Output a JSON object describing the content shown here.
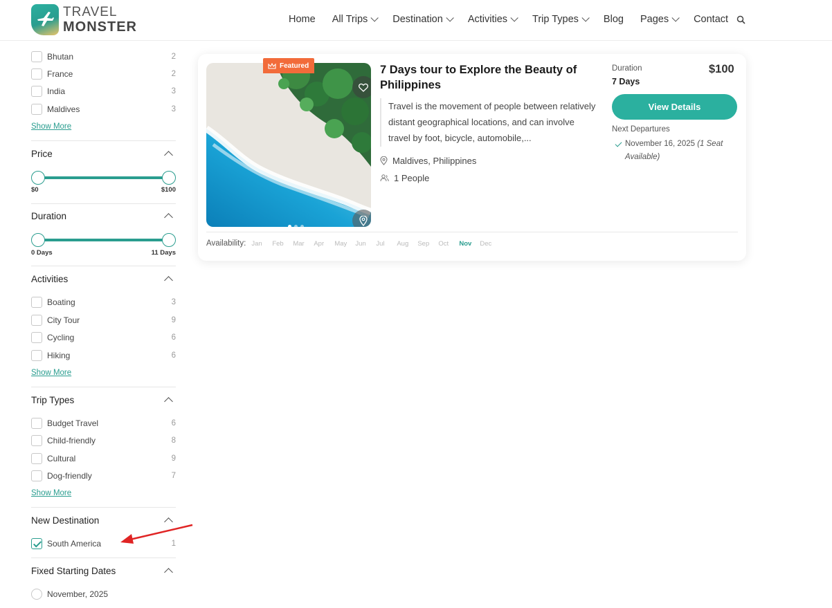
{
  "header": {
    "logo_line1": "TRAVEL",
    "logo_line2": "MONSTER",
    "nav": [
      {
        "label": "Home",
        "dropdown": false
      },
      {
        "label": "All Trips",
        "dropdown": true
      },
      {
        "label": "Destination",
        "dropdown": true
      },
      {
        "label": "Activities",
        "dropdown": true
      },
      {
        "label": "Trip Types",
        "dropdown": true
      },
      {
        "label": "Blog",
        "dropdown": false
      },
      {
        "label": "Pages",
        "dropdown": true
      },
      {
        "label": "Contact",
        "dropdown": false
      }
    ]
  },
  "sidebar": {
    "destination_items": [
      {
        "label": "Bhutan",
        "count": "2"
      },
      {
        "label": "France",
        "count": "2"
      },
      {
        "label": "India",
        "count": "3"
      },
      {
        "label": "Maldives",
        "count": "3"
      }
    ],
    "show_more": "Show More",
    "price": {
      "title": "Price",
      "min_label": "$0",
      "max_label": "$100",
      "min_fraction": 0,
      "max_fraction": 1
    },
    "duration": {
      "title": "Duration",
      "min_label": "0 Days",
      "max_label": "11 Days",
      "min_fraction": 0,
      "max_fraction": 1
    },
    "activities": {
      "title": "Activities",
      "items": [
        {
          "label": "Boating",
          "count": "3"
        },
        {
          "label": "City Tour",
          "count": "9"
        },
        {
          "label": "Cycling",
          "count": "6"
        },
        {
          "label": "Hiking",
          "count": "6"
        }
      ]
    },
    "trip_types": {
      "title": "Trip Types",
      "items": [
        {
          "label": "Budget Travel",
          "count": "6"
        },
        {
          "label": "Child-friendly",
          "count": "8"
        },
        {
          "label": "Cultural",
          "count": "9"
        },
        {
          "label": "Dog-friendly",
          "count": "7"
        }
      ]
    },
    "new_destination": {
      "title": "New Destination",
      "items": [
        {
          "label": "South America",
          "count": "1",
          "checked": true
        }
      ]
    },
    "fixed_dates": {
      "title": "Fixed Starting Dates",
      "items": [
        {
          "label": "November, 2025",
          "selected": false
        }
      ]
    }
  },
  "trip_card": {
    "badge": "Featured",
    "title": "7 Days tour to Explore the Beauty of Philippines",
    "description": "Travel is the movement of people between relatively distant geographical locations, and can involve travel by foot, bicycle, automobile,...",
    "location": "Maldives, Philippines",
    "people": "1 People",
    "duration_label": "Duration",
    "duration_value": "7 Days",
    "price": "$100",
    "button": "View Details",
    "next_departures_label": "Next Departures",
    "departure_date": "November 16, 2025",
    "departure_note": "(1 Seat Available)",
    "availability_label": "Availability:",
    "months": [
      {
        "label": "Jan",
        "available": false
      },
      {
        "label": "Feb",
        "available": false
      },
      {
        "label": "Mar",
        "available": false
      },
      {
        "label": "Apr",
        "available": false
      },
      {
        "label": "May",
        "available": false
      },
      {
        "label": "Jun",
        "available": false
      },
      {
        "label": "Jul",
        "available": false
      },
      {
        "label": "Aug",
        "available": false
      },
      {
        "label": "Sep",
        "available": false
      },
      {
        "label": "Oct",
        "available": false
      },
      {
        "label": "Nov",
        "available": true
      },
      {
        "label": "Dec",
        "available": false
      }
    ],
    "image_slides": 3,
    "active_slide": 0
  },
  "colors": {
    "accent": "#2a9d8f",
    "badge": "#f26b3a",
    "arrow": "#e02424"
  }
}
